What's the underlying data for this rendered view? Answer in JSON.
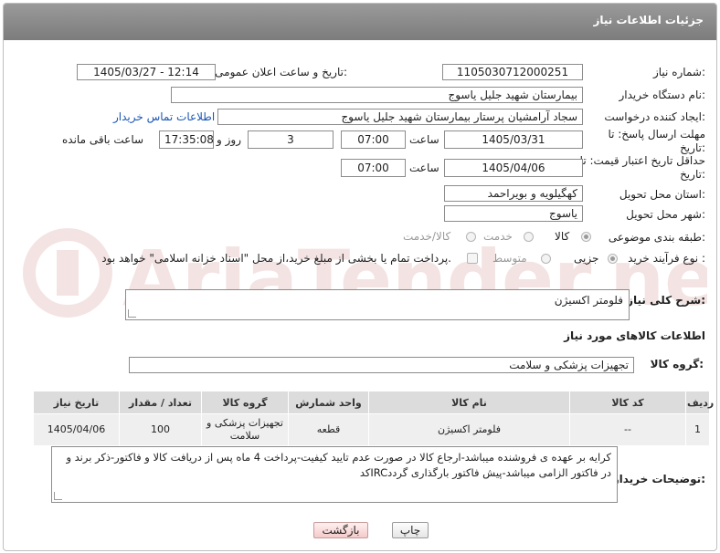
{
  "header": {
    "title": "جزئیات اطلاعات نیاز"
  },
  "watermark": {
    "text": "AriaTender.neT"
  },
  "form": {
    "need_number": {
      "label": "شماره نیاز:",
      "value": "1105030712000251"
    },
    "announce_datetime": {
      "label": "تاریخ و ساعت اعلان عمومی:",
      "value": "1405/03/27 - 12:14"
    },
    "buyer_org": {
      "label": "نام دستگاه خریدار:",
      "value": "بیمارستان شهید جلیل یاسوج"
    },
    "requester": {
      "label": "ایجاد کننده درخواست:",
      "value": "سجاد آرامشیان پرستار بیمارستان شهید جلیل یاسوج",
      "contact_link": "اطلاعات تماس خریدار"
    },
    "reply_deadline": {
      "label": "مهلت ارسال پاسخ: تا تاریخ:",
      "date": "1405/03/31",
      "time_label": "ساعت",
      "time": "07:00",
      "days": "3",
      "days_label": "روز و",
      "remaining": "17:35:08",
      "remaining_label": "ساعت باقی مانده"
    },
    "price_validity": {
      "label": "حداقل تاریخ اعتبار قیمت: تا تاریخ:",
      "date": "1405/04/06",
      "time_label": "ساعت",
      "time": "07:00"
    },
    "delivery_province": {
      "label": "استان محل تحویل:",
      "value": "کهگیلویه و بویراحمد"
    },
    "delivery_city": {
      "label": "شهر محل تحویل:",
      "value": "یاسوج"
    },
    "category": {
      "label": "طبقه بندی موضوعی:",
      "options": [
        "کالا",
        "خدمت",
        "کالا/خدمت"
      ],
      "selected": "کالا"
    },
    "process_type": {
      "label": "نوع فرآیند خرید :",
      "options": [
        "جزیی",
        "متوسط"
      ],
      "selected": "جزیی",
      "payment_note": "پرداخت تمام یا بخشی از مبلغ خرید،از محل \"اسناد خزانه اسلامی\" خواهد بود."
    },
    "general_description": {
      "label": "شرح کلی نیاز:",
      "value": "فلومتر اکسیژن"
    }
  },
  "goods_section": {
    "title": "اطلاعات کالاهای مورد نیاز",
    "group_label": "گروه کالا:",
    "group_value": "تجهیزات پزشکی و سلامت",
    "columns": [
      "ردیف",
      "کد کالا",
      "نام کالا",
      "واحد شمارش",
      "گروه کالا",
      "تعداد / مقدار",
      "تاریخ نیاز"
    ],
    "rows": [
      {
        "row": "1",
        "code": "--",
        "name": "فلومتر اکسیژن",
        "unit": "قطعه",
        "group": "تجهیزات پزشکی و سلامت",
        "qty": "100",
        "date": "1405/04/06"
      }
    ]
  },
  "buyer_notes": {
    "label": "توضیحات خریدار:",
    "line1": "کرایه بر عهده ی فروشنده میباشد-ارجاع کالا در صورت عدم تایید کیفیت-پرداخت 4 ماه پس از دریافت کالا و فاکتور-ذکر برند و",
    "line2": "کدIRCدر فاکتور الزامی میباشد-پیش فاکتور بارگذاری گردد"
  },
  "buttons": {
    "print": "چاپ",
    "back": "بازگشت"
  },
  "colors": {
    "header": "#8a8a8a",
    "link": "#1a56b5",
    "back_button": "#f5caca"
  }
}
